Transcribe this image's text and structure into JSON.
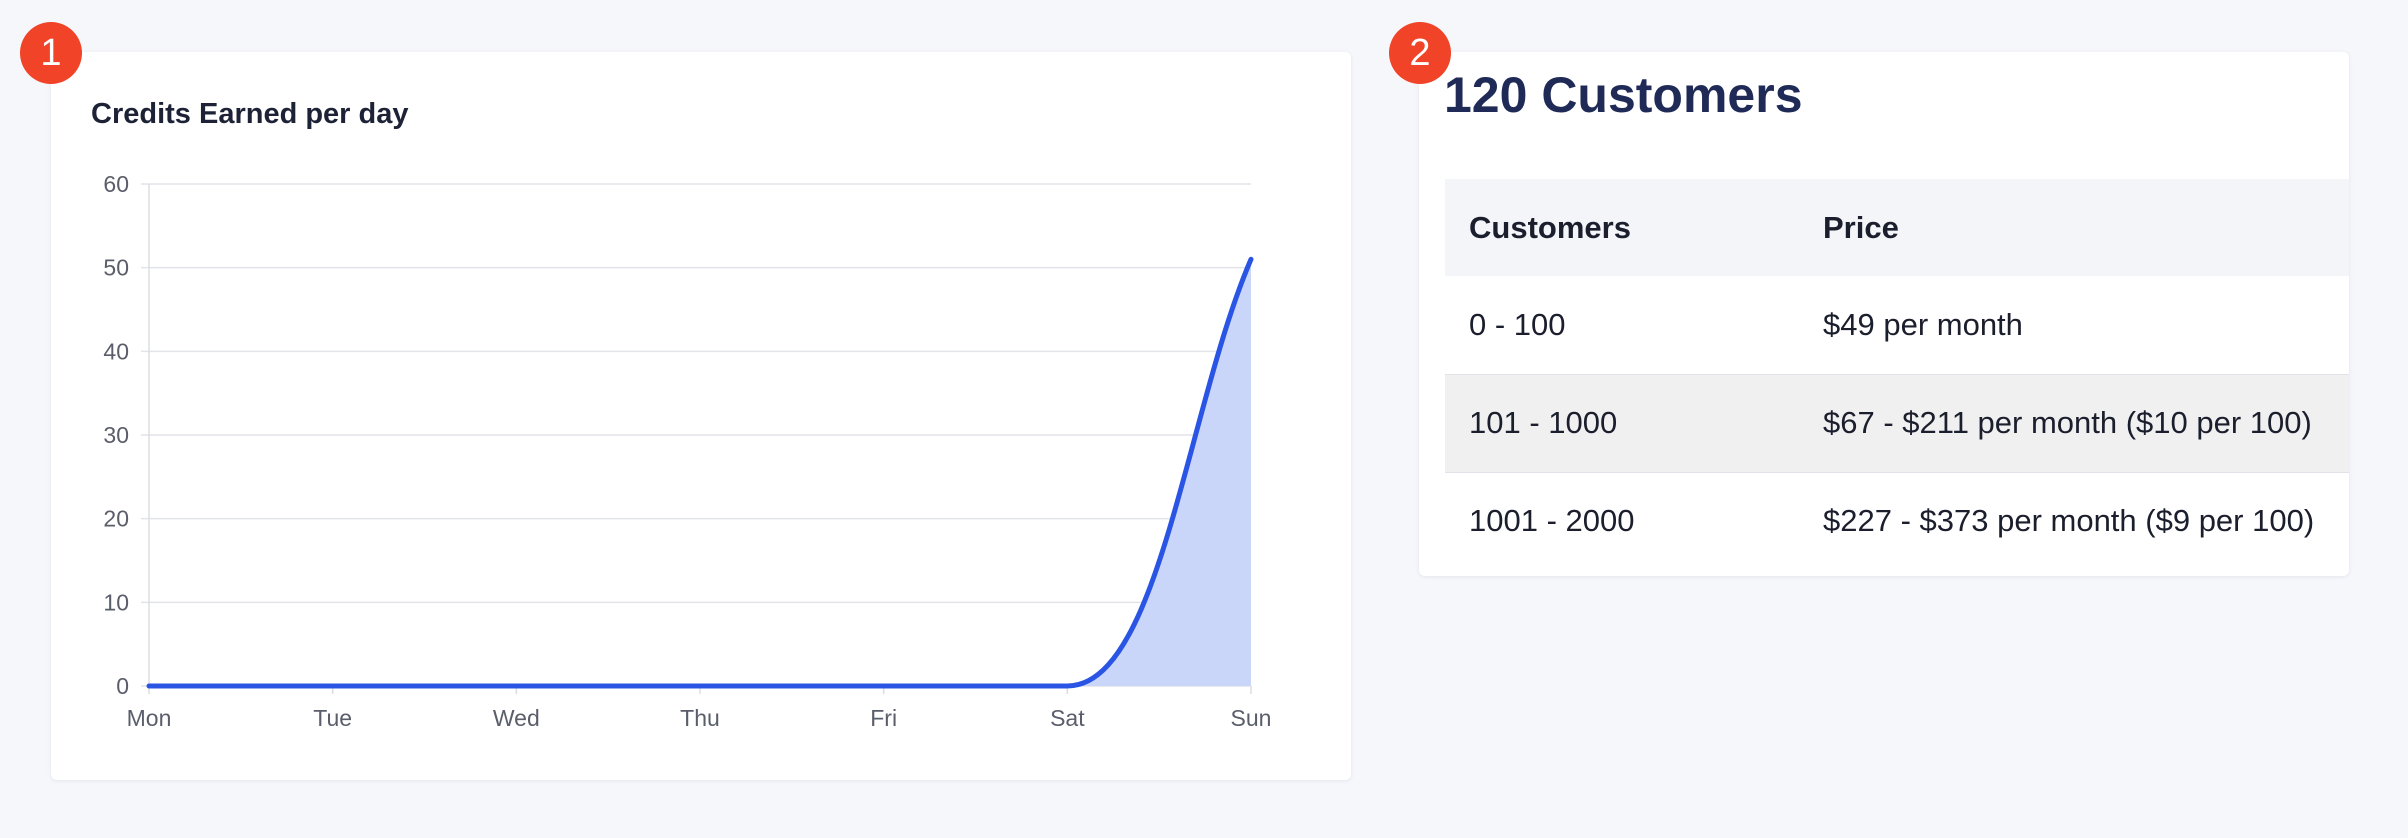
{
  "badges": {
    "first": "1",
    "second": "2"
  },
  "colors": {
    "accent_line": "#2a55e4",
    "area_fill": "#c9d6fa",
    "badge": "#f04328",
    "title_navy": "#1f2a56"
  },
  "chart_card": {
    "title": "Credits Earned per day"
  },
  "chart_data": {
    "type": "area",
    "title": "Credits Earned per day",
    "categories": [
      "Mon",
      "Tue",
      "Wed",
      "Thu",
      "Fri",
      "Sat",
      "Sun"
    ],
    "values": [
      0,
      0,
      0,
      0,
      0,
      0,
      51
    ],
    "ylim": [
      0,
      60
    ],
    "yticks": [
      0,
      10,
      20,
      30,
      40,
      50,
      60
    ],
    "grid": true,
    "legend": "none"
  },
  "customers_card": {
    "title": "120 Customers",
    "columns": [
      "Customers",
      "Price"
    ],
    "rows": [
      [
        "0 - 100",
        "$49 per month"
      ],
      [
        "101 - 1000",
        "$67 - $211 per month ($10 per 100)"
      ],
      [
        "1001 - 2000",
        "$227 - $373 per month ($9 per 100)"
      ]
    ]
  }
}
